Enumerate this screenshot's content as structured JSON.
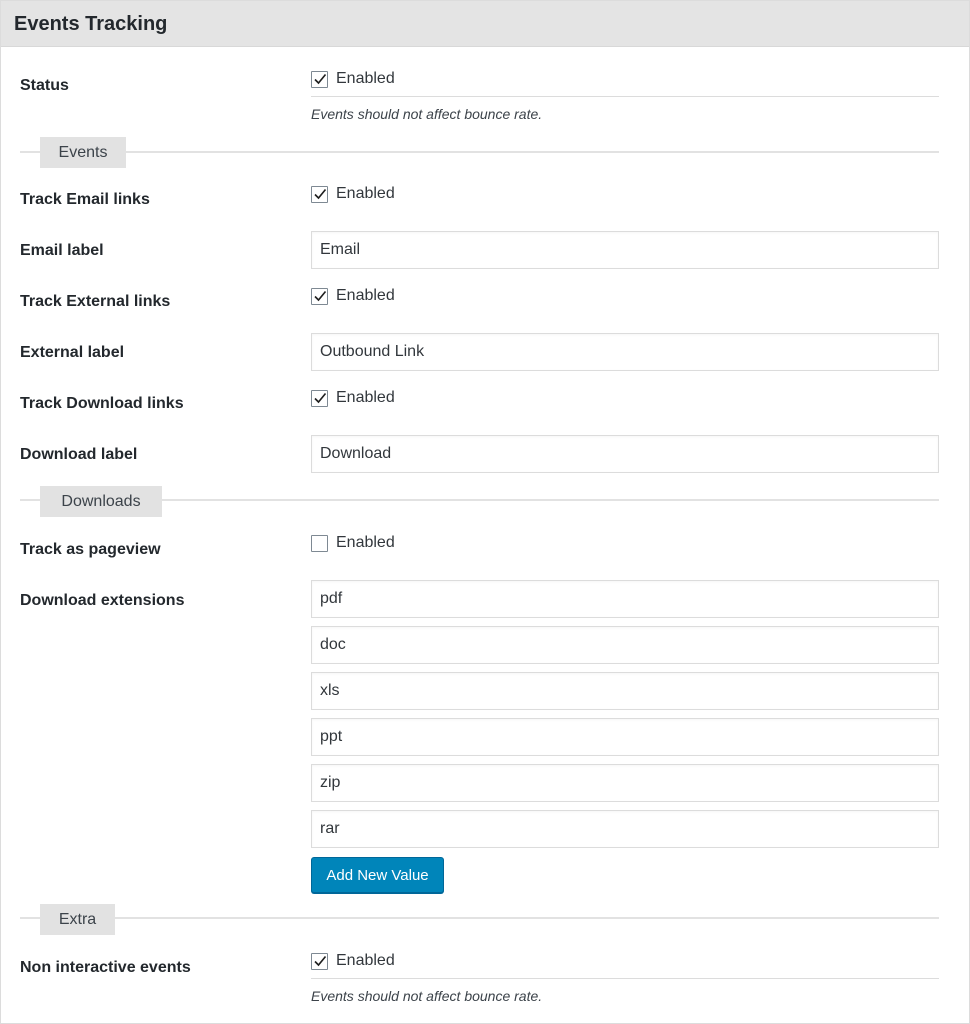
{
  "panel": {
    "title": "Events Tracking"
  },
  "status": {
    "label": "Status",
    "checkbox_label": "Enabled",
    "checked": true,
    "description": "Events should not affect bounce rate."
  },
  "sections": {
    "events": "Events",
    "downloads": "Downloads",
    "extra": "Extra"
  },
  "events": {
    "track_email": {
      "label": "Track Email links",
      "checkbox_label": "Enabled",
      "checked": true
    },
    "email_label": {
      "label": "Email label",
      "value": "Email"
    },
    "track_external": {
      "label": "Track External links",
      "checkbox_label": "Enabled",
      "checked": true
    },
    "external_label": {
      "label": "External label",
      "value": "Outbound Link"
    },
    "track_download": {
      "label": "Track Download links",
      "checkbox_label": "Enabled",
      "checked": true
    },
    "download_label": {
      "label": "Download label",
      "value": "Download"
    }
  },
  "downloads": {
    "track_pageview": {
      "label": "Track as pageview",
      "checkbox_label": "Enabled",
      "checked": false
    },
    "extensions_label": "Download extensions",
    "extensions": [
      "pdf",
      "doc",
      "xls",
      "ppt",
      "zip",
      "rar"
    ],
    "add_button": "Add New Value"
  },
  "extra": {
    "non_interactive": {
      "label": "Non interactive events",
      "checkbox_label": "Enabled",
      "checked": true
    },
    "description": "Events should not affect bounce rate."
  },
  "colors": {
    "accent": "#0085ba",
    "header_bg": "#e4e4e4",
    "section_bg": "#e2e2e2"
  }
}
